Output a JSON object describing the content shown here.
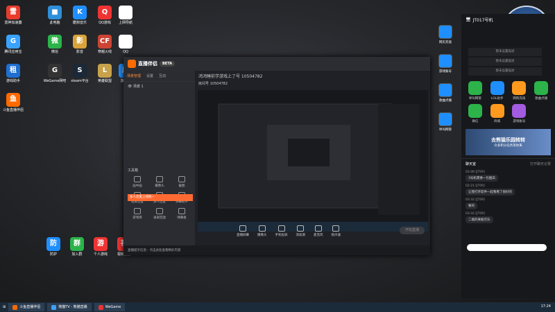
{
  "desktop": {
    "col1": [
      {
        "label": "雷神加速器",
        "color": "#e83b2c",
        "glyph": "雷"
      },
      {
        "label": "腾讯应用宝",
        "color": "#3aa3ff",
        "glyph": "G"
      },
      {
        "label": "游戏助手",
        "color": "#1f6fd1",
        "glyph": "租"
      },
      {
        "label": "斗鱼直播伴侣",
        "color": "#ff6a00",
        "glyph": "鱼"
      }
    ],
    "col2": [
      {
        "label": "此电脑",
        "color": "#2f8fd8",
        "glyph": "■"
      },
      {
        "label": "微信",
        "color": "#2cb34a",
        "glyph": "微"
      },
      {
        "label": "WeGame网吧",
        "color": "#333",
        "glyph": "G"
      }
    ],
    "col3": [
      {
        "label": "酷狗音乐",
        "color": "#1f8fff",
        "glyph": "K"
      },
      {
        "label": "影音",
        "color": "#d9a23a",
        "glyph": "影"
      },
      {
        "label": "steam平台",
        "color": "#1b2838",
        "glyph": "S"
      }
    ],
    "col4": [
      {
        "label": "QQ游戏",
        "color": "#e33",
        "glyph": "Q"
      },
      {
        "label": "穿越火线",
        "color": "#c43",
        "glyph": "CF"
      },
      {
        "label": "英雄联盟",
        "color": "#c8a24a",
        "glyph": "L"
      }
    ],
    "col5": [
      {
        "label": "上网导航",
        "color": "#fff",
        "glyph": "◉"
      },
      {
        "label": "QQ",
        "color": "#fff",
        "glyph": "Q"
      },
      {
        "label": "游戏库",
        "color": "#1f8fff",
        "glyph": "库"
      }
    ],
    "bottom": [
      {
        "label": "防护",
        "color": "#1f8fff",
        "glyph": "防"
      },
      {
        "label": "加入群",
        "color": "#2cb34a",
        "glyph": "群"
      },
      {
        "label": "个人游戏",
        "color": "#e33",
        "glyph": "游"
      },
      {
        "label": "视频播放",
        "color": "#e33",
        "glyph": "视"
      }
    ]
  },
  "app": {
    "name": "直播伴侣",
    "version": "BETA",
    "left_tabs": [
      "场景管理",
      "设置",
      "互动"
    ],
    "scene": "场景 1",
    "tools_title": "工具箱",
    "promo": "多人连麦上线啦~",
    "tools": [
      "画中画",
      "摄像头",
      "截图",
      "投屏连麦",
      "多人连麦",
      "弹幕助手",
      "游戏库",
      "录屏回放",
      "弹幕板"
    ],
    "stream_title": "鸿鸿睡前学游戏上了号 10504782",
    "stream_sub": "房间号 10504782",
    "controls": [
      "直播屏幕",
      "摄像头",
      "手机投屏",
      "添加源",
      "麦克风",
      "扬声器"
    ],
    "golive": "开始直播",
    "status": "直播提示信息：点击此处查看精彩内容"
  },
  "side_icons": [
    {
      "label": "网页充值",
      "color": "#1f8fff"
    },
    {
      "label": "游戏账号",
      "color": "#1f8fff"
    },
    {
      "label": "歌曲点播",
      "color": "#1f8fff"
    },
    {
      "label": "呼叫网管",
      "color": "#1f8fff"
    }
  ],
  "badge": {
    "top": "斗鱼",
    "room": "10504782"
  },
  "panel": {
    "title": "JT017号机",
    "buttons": [
      "暂未设置描述",
      "暂未设置描述",
      "暂未设置描述"
    ],
    "apps": [
      {
        "label": "呼叫网管",
        "color": "#2cb34a"
      },
      {
        "label": "LOL助手",
        "color": "#1f8fff"
      },
      {
        "label": "网购充值",
        "color": "#ff9a1f"
      },
      {
        "label": "歌曲点播",
        "color": "#2cb34a"
      },
      {
        "label": "微信",
        "color": "#2cb34a"
      },
      {
        "label": "商城",
        "color": "#ff9a1f"
      },
      {
        "label": "游戏账号",
        "color": "#a35be0"
      }
    ],
    "banner": "去熊猫乐园转转",
    "banner_sub": "众多积分任务等你来",
    "chat_title": "聊天室",
    "chat_link": "打开聊天记录",
    "messages": [
      {
        "meta": "02:06 [JT09]",
        "text": "3号机需要一包烟白"
      },
      {
        "meta": "02:21 [JT09]",
        "text": "让我打开软件一起看看了很好的"
      },
      {
        "meta": "03:32 [JT09]",
        "text": "要的"
      },
      {
        "meta": "03:32 [JT09]",
        "text": "二瓶的来瓶可乐"
      }
    ]
  },
  "taskbar": {
    "items": [
      {
        "label": "斗鱼直播伴侣",
        "color": "#ff6a00"
      },
      {
        "label": "熊猫TV - 熊猫直播",
        "color": "#3aa3ff"
      },
      {
        "label": "WeGame",
        "color": "#e33"
      }
    ],
    "clock": "17:24"
  }
}
